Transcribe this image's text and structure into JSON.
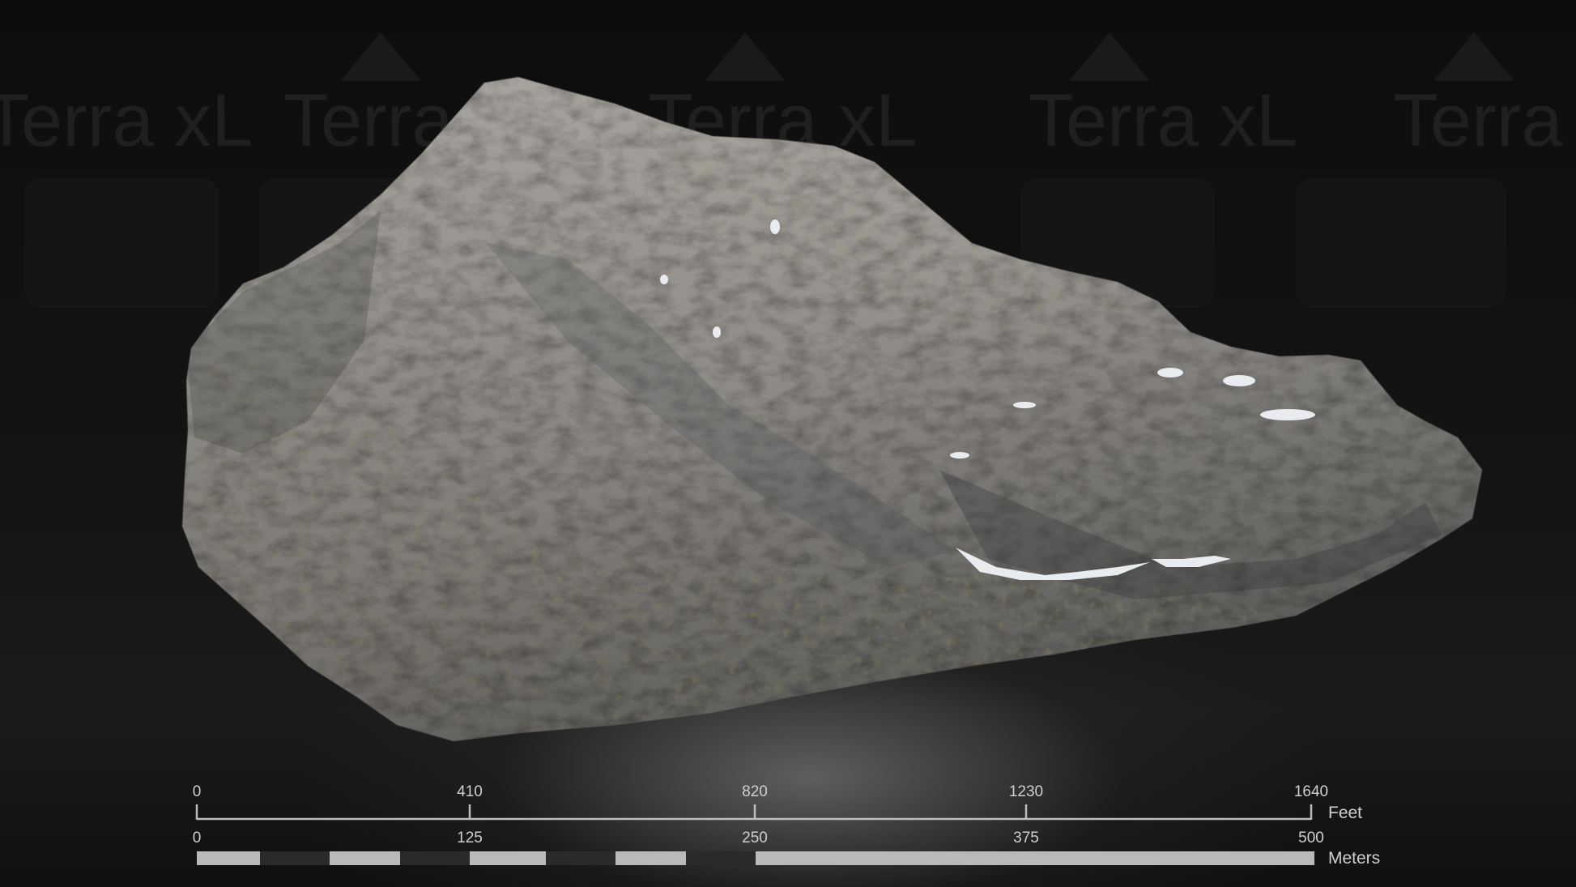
{
  "watermark": {
    "text": "Terra xL"
  },
  "scale_bar": {
    "feet": {
      "unit": "Feet",
      "ticks": [
        "0",
        "410",
        "820",
        "1230",
        "1640"
      ]
    },
    "meters": {
      "unit": "Meters",
      "ticks": [
        "0",
        "125",
        "250",
        "375",
        "500"
      ]
    }
  },
  "colors": {
    "background": "#0b0b0b",
    "rock": "#9b9893",
    "vegetation": "#6f6a3a",
    "scale_text": "#cfcfcf",
    "scale_light": "#b9b9b9",
    "scale_dark": "#2a2a2a"
  }
}
